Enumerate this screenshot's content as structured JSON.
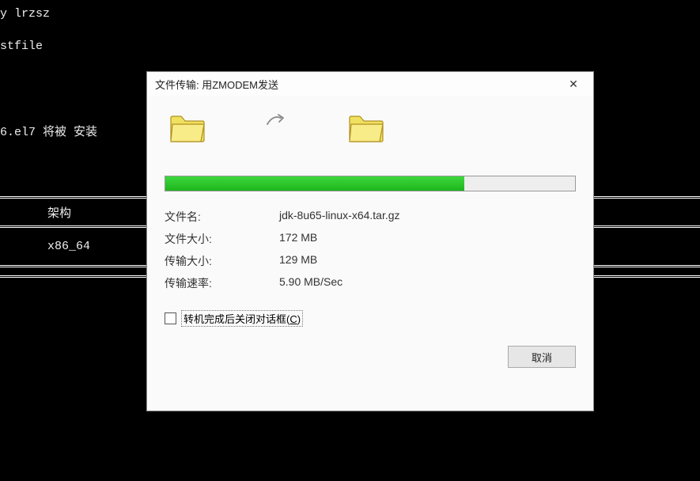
{
  "terminal": {
    "line1": "y lrzsz",
    "line2": "stfile",
    "line3": "6.el7 将被 安装",
    "table_header": "架构",
    "table_value": "x86_64"
  },
  "dialog": {
    "title": "文件传输: 用ZMODEM发送",
    "close": "✕",
    "progress_percent": 73,
    "info": {
      "filename_label": "文件名:",
      "filename_value": "jdk-8u65-linux-x64.tar.gz",
      "filesize_label": "文件大小:",
      "filesize_value": "172 MB",
      "transfersize_label": "传输大小:",
      "transfersize_value": "129 MB",
      "speed_label": "传输速率:",
      "speed_value": "5.90 MB/Sec"
    },
    "checkbox_label_prefix": "转机完成后关闭对话框(",
    "checkbox_accel": "C",
    "checkbox_label_suffix": ")",
    "cancel_button": "取消"
  }
}
